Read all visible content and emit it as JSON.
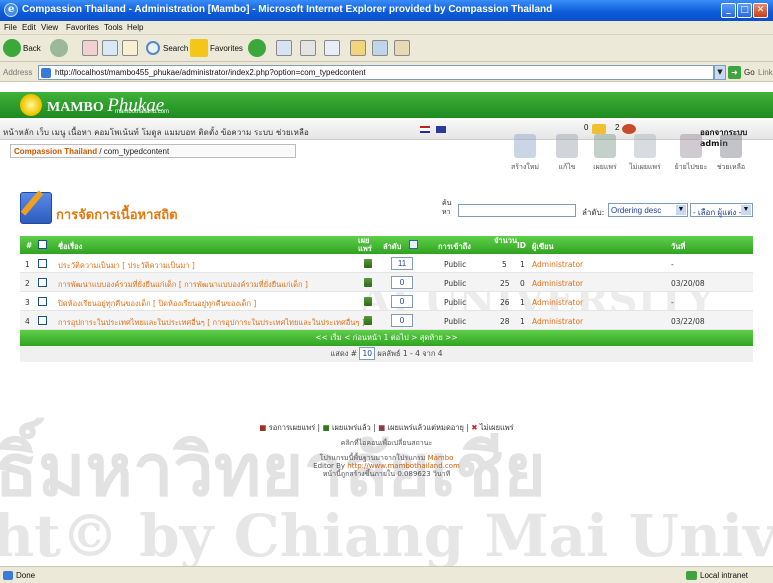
{
  "window": {
    "title": "Compassion Thailand - Administration [Mambo] - Microsoft Internet Explorer provided by Compassion Thailand",
    "min": "_",
    "max": "□",
    "close": "✕"
  },
  "menubar": [
    "File",
    "Edit",
    "View",
    "Favorites",
    "Tools",
    "Help"
  ],
  "toolbar": {
    "back": "Back",
    "search": "Search",
    "favorites": "Favorites"
  },
  "address": {
    "label": "Address",
    "url": "http://localhost/mambo455_phukae/administrator/index2.php?option=com_typedcontent",
    "go": "Go",
    "links": "Links"
  },
  "banner": {
    "brand_main": "MAMBO",
    "brand_italic": "Phukae",
    "brand_sub": "mambothailand.com"
  },
  "admin_menu": {
    "items": "หน้าหลัก  เว็บ  เมนู  เนื้อหา  คอมโพเน้นท์  โมดูล  แมมบอท  ติดตั้ง  ข้อความ  ระบบ  ช่วยเหลือ",
    "mail_count": "0",
    "users_count": "2",
    "logout": "ออกจากระบบ admin"
  },
  "path": {
    "site": "Compassion Thailand",
    "component": "/ com_typedcontent"
  },
  "actions": [
    {
      "label": "สร้างใหม่",
      "color": "#8aa4c8"
    },
    {
      "label": "แก้ไข",
      "color": "#9aa0a8"
    },
    {
      "label": "เผยแพร่",
      "color": "#7a9a8a"
    },
    {
      "label": "ไม่เผยแพร่",
      "color": "#a8b0b8"
    },
    {
      "label": "ย้ายไปขยะ",
      "color": "#9a8a9a"
    },
    {
      "label": "ช่วยเหลือ",
      "color": "#7a7a8a"
    }
  ],
  "heading": "การจัดการเนื้อหาสถิต",
  "filter": {
    "label": "ค้นหา",
    "order_label": "ลำดับ:",
    "order_value": "Ordering desc",
    "author_value": "- เลือก ผู้แต่ง -"
  },
  "table": {
    "headers": {
      "num": "#",
      "title": "ชื่อเรื่อง",
      "published": "เผยแพร่",
      "order": "ลำดับ",
      "access": "การเข้าถึง",
      "hits": "จำนวน",
      "id": "ID",
      "author": "ผู้เขียน",
      "date": "วันที่"
    },
    "rows": [
      {
        "num": "1",
        "title": "ประวัติความเป็นมา [ ประวัติความเป็นมา ]",
        "order": "11",
        "access": "Public",
        "hits": "5",
        "id": "1",
        "author": "Administrator",
        "date": "-"
      },
      {
        "num": "2",
        "title": "การพัฒนาแบบองค์รวมที่ยั่งยืนแก่เด็ก [ การพัฒนาแบบองค์รวมที่ยั่งยืนแก่เด็ก ]",
        "order": "0",
        "access": "Public",
        "hits": "25",
        "id": "0",
        "author": "Administrator",
        "date": "03/20/08"
      },
      {
        "num": "3",
        "title": "ปิดห้องเรียนอยู่ทุกคืนของเด็ก [ ปิดห้องเรียนอยู่ทุกคืนของเด็ก ]",
        "order": "0",
        "access": "Public",
        "hits": "26",
        "id": "1",
        "author": "Administrator",
        "date": "-"
      },
      {
        "num": "4",
        "title": "การอุปการะในประเทศไทยและในประเทศอื่นๆ [ การอุปการะในประเทศไทยและในประเทศอื่นๆ ]",
        "order": "0",
        "access": "Public",
        "hits": "28",
        "id": "1",
        "author": "Administrator",
        "date": "03/22/08"
      }
    ],
    "pagination": "<< เริ่ม < ก่อนหน้า 1 ต่อไป > สุดท้าย >>",
    "display_label": "แสดง #",
    "display_value": "10",
    "results": "ผลลัพธ์ 1 - 4 จาก 4"
  },
  "legend": {
    "scheduled": "รอการเผยแพร่",
    "published_current": "เผยแพร่แล้ว",
    "published_expired": "เผยแพร่แล้วแต่หมดอายุ",
    "unpublished": "ไม่เผยแพร่",
    "hint": "คลิกที่ไอคอนเพื่อเปลี่ยนสถานะ"
  },
  "footer": {
    "line1_prefix": "โปรแกรมนี้พื้นฐานมาจากโปรแกรม",
    "line1_link": "Mambo",
    "line2_prefix": "Editor By",
    "line2_link": "http://www.mambothailand.com",
    "line3": "หน้านี้ถูกสร้างขึ้นภายใน 0.089623 วินาที"
  },
  "watermark": {
    "thai": "ธิ์มหาวิทยาลัยเชีย",
    "latin": "ht© by Chiang Mai Univ",
    "mid": "AI UNIVERSITY"
  },
  "status": {
    "left": "Done",
    "zone": "Local intranet"
  }
}
